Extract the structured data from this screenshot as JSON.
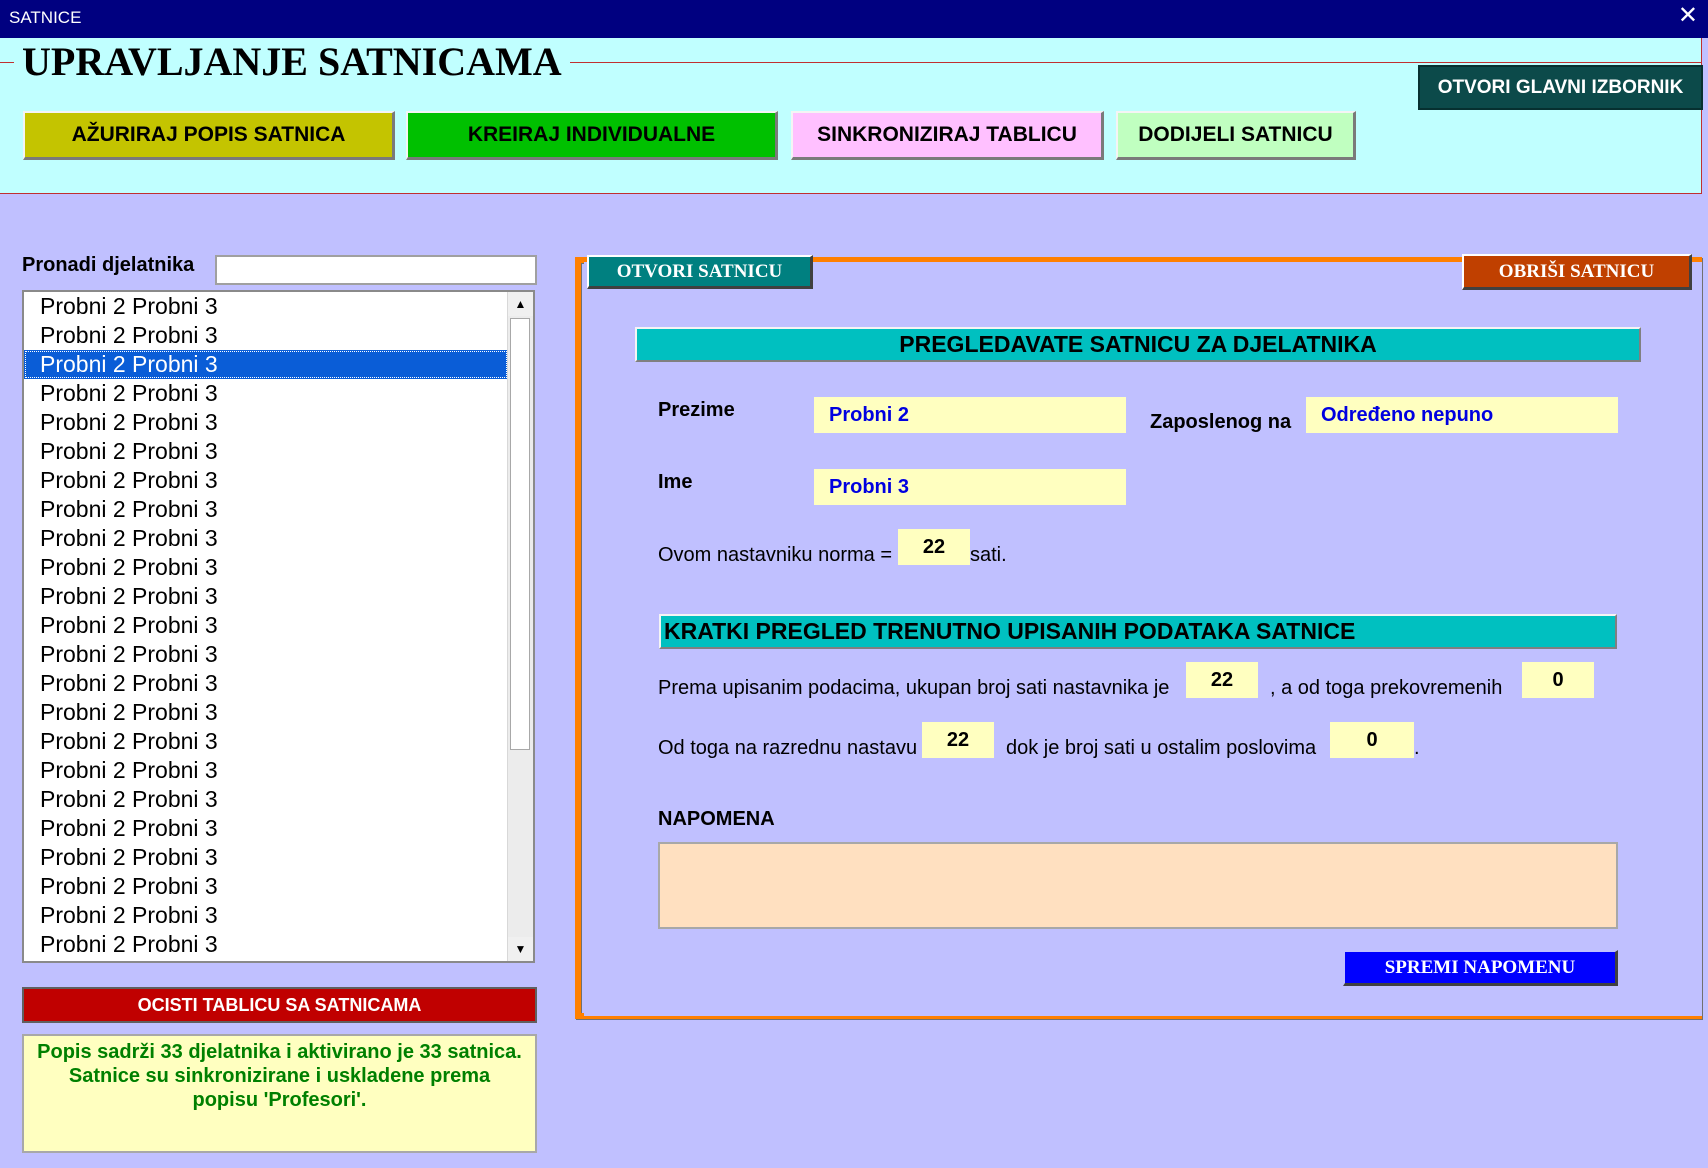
{
  "window": {
    "title": "SATNICE",
    "close_glyph": "✕"
  },
  "header": {
    "title": "UPRAVLJANJE SATNICAMA",
    "main_menu_button": "OTVORI GLAVNI IZBORNIK",
    "buttons": [
      {
        "label": "AŽURIRAJ POPIS SATNICA",
        "color": "#c4c400"
      },
      {
        "label": "KREIRAJ INDIVIDUALNE",
        "color": "#00c000"
      },
      {
        "label": "SINKRONIZIRAJ TABLICU",
        "color": "#ffc0ff"
      },
      {
        "label": "DODIJELI SATNICU",
        "color": "#c0ffc0"
      }
    ]
  },
  "left": {
    "search_label": "Pronadi djelatnika",
    "search_value": "",
    "list": {
      "items": [
        "Probni 2 Probni 3",
        "Probni 2 Probni 3",
        "Probni 2 Probni 3",
        "Probni 2 Probni 3",
        "Probni 2 Probni 3",
        "Probni 2 Probni 3",
        "Probni 2 Probni 3",
        "Probni 2 Probni 3",
        "Probni 2 Probni 3",
        "Probni 2 Probni 3",
        "Probni 2 Probni 3",
        "Probni 2 Probni 3",
        "Probni 2 Probni 3",
        "Probni 2 Probni 3",
        "Probni 2 Probni 3",
        "Probni 2 Probni 3",
        "Probni 2 Probni 3",
        "Probni 2 Probni 3",
        "Probni 2 Probni 3",
        "Probni 2 Probni 3",
        "Probni 2 Probni 3",
        "Probni 2 Probni 3",
        "Probni 2 Probni 3"
      ],
      "selected_index": 2,
      "scroll_up_glyph": "▲",
      "scroll_down_glyph": "▼"
    },
    "clear_button": "OCISTI TABLICU SA SATNICAMA",
    "status_message": "Popis sadrži 33 djelatnika i aktivirano je 33 satnica.\nSatnice su sinkronizirane i uskladene prema popisu 'Profesori'."
  },
  "panel": {
    "tab_open": "OTVORI SATNICU",
    "tab_delete": "OBRIŠI SATNICU",
    "section_title": "PREGLEDAVATE SATNICU ZA DJELATNIKA",
    "surname_label": "Prezime",
    "surname_value": "Probni 2",
    "employed_label": "Zaposlenog na",
    "employed_value": "Određeno nepuno",
    "name_label": "Ime",
    "name_value": "Probni 3",
    "norm_prefix": "Ovom nastavniku norma =",
    "norm_value": "22",
    "norm_suffix": "sati.",
    "summary_title": "KRATKI PREGLED TRENUTNO UPISANIH PODATAKA SATNICE",
    "total_prefix": "Prema upisanim podacima, ukupan broj sati nastavnika je",
    "total_value": "22",
    "overtime_prefix": ", a od toga prekovremenih",
    "overtime_value": "0",
    "class_prefix": "Od toga na razrednu nastavu",
    "class_value": "22",
    "other_prefix": "dok je broj sati u ostalim poslovima",
    "other_value": "0",
    "other_suffix": ".",
    "note_label": "NAPOMENA",
    "note_value": "",
    "save_note_button": "SPREMI NAPOMENU"
  }
}
